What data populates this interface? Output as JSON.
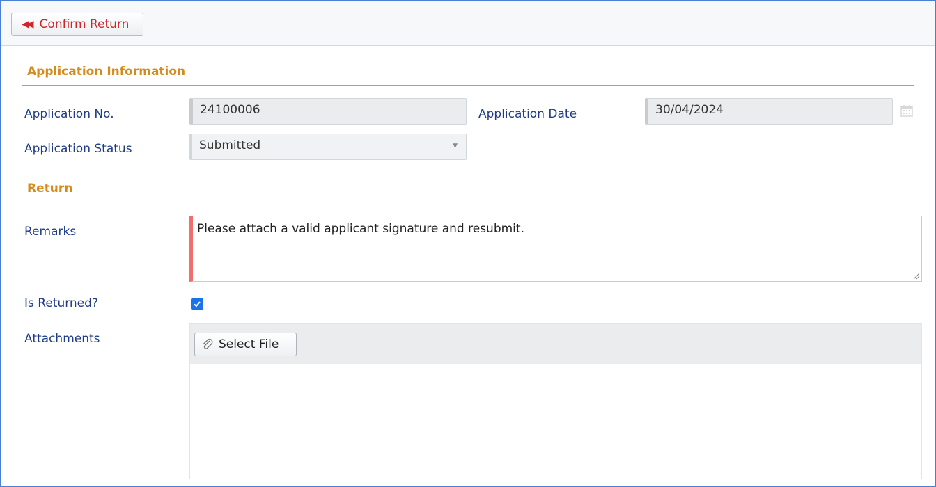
{
  "toolbar": {
    "confirm_return_label": "Confirm Return",
    "confirm_return_icon": "double-chevron-left-icon"
  },
  "application_information": {
    "title": "Application Information",
    "application_no_label": "Application No.",
    "application_no_value": "24100006",
    "application_date_label": "Application Date",
    "application_date_value": "30/04/2024",
    "application_status_label": "Application Status",
    "application_status_value": "Submitted"
  },
  "return_section": {
    "title": "Return",
    "remarks_label": "Remarks",
    "remarks_value": "Please attach a valid applicant signature and resubmit.",
    "is_returned_label": "Is Returned?",
    "is_returned_checked": true,
    "attachments_label": "Attachments",
    "select_file_label": "Select File",
    "select_file_icon": "paperclip-icon"
  },
  "colors": {
    "accent_blue": "#1a73e8",
    "label_blue": "#1f3c88",
    "section_orange": "#d68a1c",
    "required_red": "#f26d6d",
    "confirm_red": "#d2232a"
  }
}
